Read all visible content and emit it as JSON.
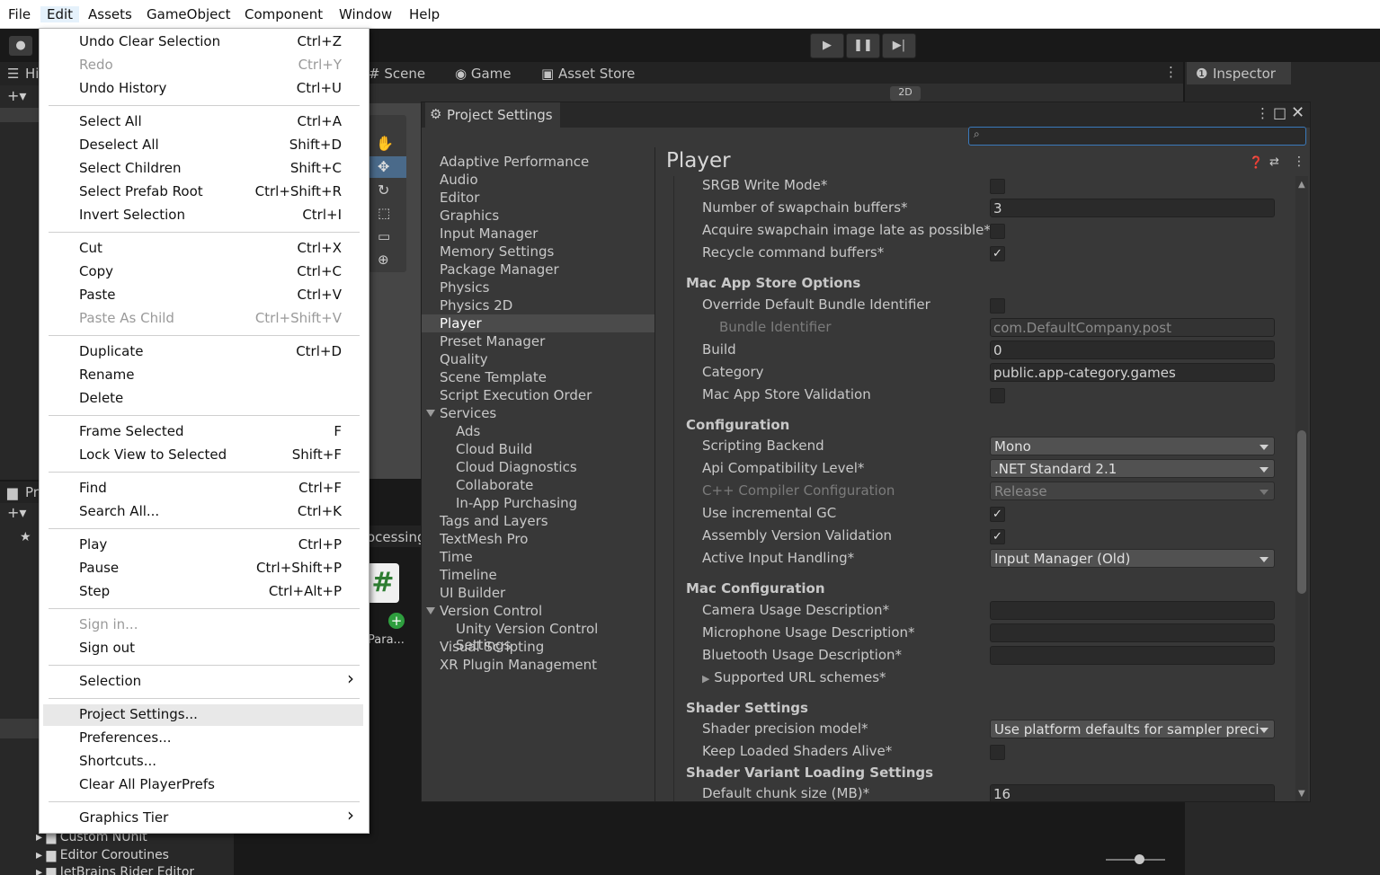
{
  "menubar": {
    "items": [
      "File",
      "Edit",
      "Assets",
      "GameObject",
      "Component",
      "Window",
      "Help"
    ]
  },
  "scene_tabs": {
    "hierarchy": "Hi",
    "project": "Pr",
    "scene": "Scene",
    "game": "Game",
    "asset_store": "Asset Store",
    "inspector": "Inspector",
    "processing": "ocessing",
    "para_label": "Para...",
    "two_d": "2D"
  },
  "bottom_tree": [
    "Custom NUnit",
    "Editor Coroutines",
    "JetBrains Rider Editor"
  ],
  "edit_menu": {
    "groups": [
      [
        {
          "label": "Undo Clear Selection",
          "shortcut": "Ctrl+Z",
          "disabled": false
        },
        {
          "label": "Redo",
          "shortcut": "Ctrl+Y",
          "disabled": true
        },
        {
          "label": "Undo History",
          "shortcut": "Ctrl+U",
          "disabled": false
        }
      ],
      [
        {
          "label": "Select All",
          "shortcut": "Ctrl+A",
          "disabled": false
        },
        {
          "label": "Deselect All",
          "shortcut": "Shift+D",
          "disabled": false
        },
        {
          "label": "Select Children",
          "shortcut": "Shift+C",
          "disabled": false
        },
        {
          "label": "Select Prefab Root",
          "shortcut": "Ctrl+Shift+R",
          "disabled": false
        },
        {
          "label": "Invert Selection",
          "shortcut": "Ctrl+I",
          "disabled": false
        }
      ],
      [
        {
          "label": "Cut",
          "shortcut": "Ctrl+X",
          "disabled": false
        },
        {
          "label": "Copy",
          "shortcut": "Ctrl+C",
          "disabled": false
        },
        {
          "label": "Paste",
          "shortcut": "Ctrl+V",
          "disabled": false
        },
        {
          "label": "Paste As Child",
          "shortcut": "Ctrl+Shift+V",
          "disabled": true
        }
      ],
      [
        {
          "label": "Duplicate",
          "shortcut": "Ctrl+D",
          "disabled": false
        },
        {
          "label": "Rename",
          "shortcut": "",
          "disabled": false
        },
        {
          "label": "Delete",
          "shortcut": "",
          "disabled": false
        }
      ],
      [
        {
          "label": "Frame Selected",
          "shortcut": "F",
          "disabled": false
        },
        {
          "label": "Lock View to Selected",
          "shortcut": "Shift+F",
          "disabled": false
        }
      ],
      [
        {
          "label": "Find",
          "shortcut": "Ctrl+F",
          "disabled": false
        },
        {
          "label": "Search All...",
          "shortcut": "Ctrl+K",
          "disabled": false
        }
      ],
      [
        {
          "label": "Play",
          "shortcut": "Ctrl+P",
          "disabled": false
        },
        {
          "label": "Pause",
          "shortcut": "Ctrl+Shift+P",
          "disabled": false
        },
        {
          "label": "Step",
          "shortcut": "Ctrl+Alt+P",
          "disabled": false
        }
      ],
      [
        {
          "label": "Sign in...",
          "shortcut": "",
          "disabled": true
        },
        {
          "label": "Sign out",
          "shortcut": "",
          "disabled": false
        }
      ],
      [
        {
          "label": "Selection",
          "shortcut": "›",
          "disabled": false
        }
      ],
      [
        {
          "label": "Project Settings...",
          "shortcut": "",
          "disabled": false,
          "highlighted": true
        },
        {
          "label": "Preferences...",
          "shortcut": "",
          "disabled": false
        },
        {
          "label": "Shortcuts...",
          "shortcut": "",
          "disabled": false
        },
        {
          "label": "Clear All PlayerPrefs",
          "shortcut": "",
          "disabled": false
        }
      ],
      [
        {
          "label": "Graphics Tier",
          "shortcut": "›",
          "disabled": false
        }
      ]
    ]
  },
  "project_settings": {
    "title": "Project Settings",
    "page_title": "Player",
    "nav": [
      {
        "label": "Adaptive Performance",
        "level": 0
      },
      {
        "label": "Audio",
        "level": 0
      },
      {
        "label": "Editor",
        "level": 0
      },
      {
        "label": "Graphics",
        "level": 0
      },
      {
        "label": "Input Manager",
        "level": 0
      },
      {
        "label": "Memory Settings",
        "level": 0
      },
      {
        "label": "Package Manager",
        "level": 0
      },
      {
        "label": "Physics",
        "level": 0
      },
      {
        "label": "Physics 2D",
        "level": 0
      },
      {
        "label": "Player",
        "level": 0,
        "selected": true
      },
      {
        "label": "Preset Manager",
        "level": 0
      },
      {
        "label": "Quality",
        "level": 0
      },
      {
        "label": "Scene Template",
        "level": 0
      },
      {
        "label": "Script Execution Order",
        "level": 0
      },
      {
        "label": "Services",
        "level": 0,
        "expanded": true
      },
      {
        "label": "Ads",
        "level": 1
      },
      {
        "label": "Cloud Build",
        "level": 1
      },
      {
        "label": "Cloud Diagnostics",
        "level": 1
      },
      {
        "label": "Collaborate",
        "level": 1
      },
      {
        "label": "In-App Purchasing",
        "level": 1
      },
      {
        "label": "Tags and Layers",
        "level": 0
      },
      {
        "label": "TextMesh Pro",
        "level": 0
      },
      {
        "label": "Time",
        "level": 0
      },
      {
        "label": "Timeline",
        "level": 0
      },
      {
        "label": "UI Builder",
        "level": 0
      },
      {
        "label": "Version Control",
        "level": 0,
        "expanded": true
      },
      {
        "label": "Unity Version Control Settings",
        "level": 1
      },
      {
        "label": "Visual Scripting",
        "level": 0
      },
      {
        "label": "XR Plugin Management",
        "level": 0
      }
    ],
    "rows": [
      {
        "kind": "check",
        "label": "SRGB Write Mode*",
        "checked": false
      },
      {
        "kind": "field",
        "label": "Number of swapchain buffers*",
        "value": "3"
      },
      {
        "kind": "check",
        "label": "Acquire swapchain image late as possible*",
        "checked": false
      },
      {
        "kind": "check",
        "label": "Recycle command buffers*",
        "checked": true
      },
      {
        "kind": "header",
        "label": "Mac App Store Options"
      },
      {
        "kind": "check",
        "label": "Override Default Bundle Identifier",
        "checked": false
      },
      {
        "kind": "field",
        "label": "Bundle Identifier",
        "value": "com.DefaultCompany.post",
        "dim": true,
        "indent": true
      },
      {
        "kind": "field",
        "label": "Build",
        "value": "0"
      },
      {
        "kind": "field",
        "label": "Category",
        "value": "public.app-category.games"
      },
      {
        "kind": "check",
        "label": "Mac App Store Validation",
        "checked": false
      },
      {
        "kind": "header",
        "label": "Configuration"
      },
      {
        "kind": "dropdown",
        "label": "Scripting Backend",
        "value": "Mono"
      },
      {
        "kind": "dropdown",
        "label": "Api Compatibility Level*",
        "value": ".NET Standard 2.1"
      },
      {
        "kind": "dropdown",
        "label": "C++ Compiler Configuration",
        "value": "Release",
        "dim": true
      },
      {
        "kind": "check",
        "label": "Use incremental GC",
        "checked": true
      },
      {
        "kind": "check",
        "label": "Assembly Version Validation",
        "checked": true
      },
      {
        "kind": "dropdown",
        "label": "Active Input Handling*",
        "value": "Input Manager (Old)"
      },
      {
        "kind": "header",
        "label": "Mac Configuration"
      },
      {
        "kind": "field",
        "label": "Camera Usage Description*",
        "value": ""
      },
      {
        "kind": "field",
        "label": "Microphone Usage Description*",
        "value": ""
      },
      {
        "kind": "field",
        "label": "Bluetooth Usage Description*",
        "value": ""
      },
      {
        "kind": "foldout",
        "label": "Supported URL schemes*"
      },
      {
        "kind": "header",
        "label": "Shader Settings"
      },
      {
        "kind": "dropdown",
        "label": "Shader precision model*",
        "value": "Use platform defaults for sampler precision"
      },
      {
        "kind": "check",
        "label": "Keep Loaded Shaders Alive*",
        "checked": false
      },
      {
        "kind": "header",
        "label": "Shader Variant Loading Settings"
      },
      {
        "kind": "field",
        "label": "Default chunk size (MB)*",
        "value": "16"
      }
    ]
  }
}
